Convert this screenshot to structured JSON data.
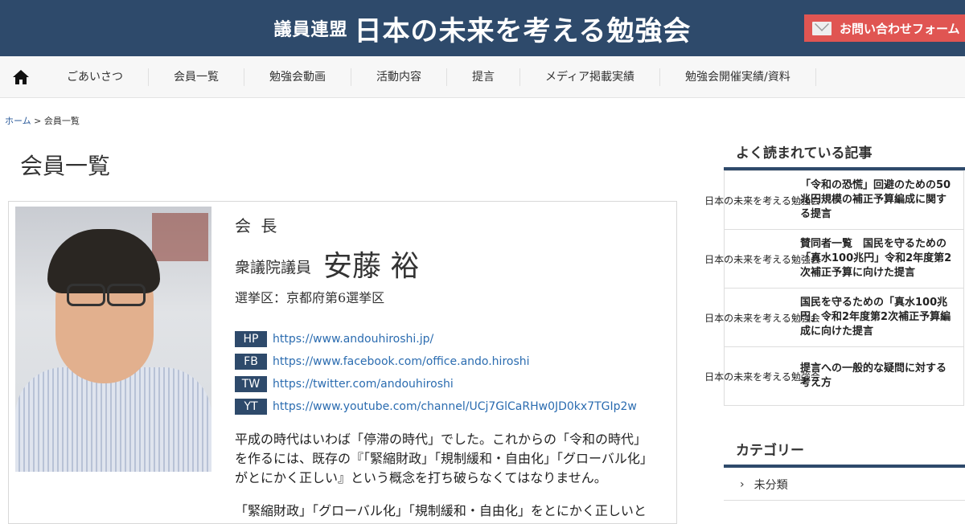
{
  "header": {
    "subtitle": "議員連盟",
    "title": "日本の未来を考える勉強会",
    "contact_label": "お問い合わせフォーム",
    "bg": "#2e4a6b",
    "contact_bg": "#e05552"
  },
  "nav": {
    "home_icon": "home-icon",
    "items": [
      "ごあいさつ",
      "会員一覧",
      "勉強会動画",
      "活動内容",
      "提言",
      "メディア掲載実績",
      "勉強会開催実績/資料"
    ]
  },
  "breadcrumb": {
    "home": "ホーム",
    "sep": ">",
    "current": "会員一覧"
  },
  "page_title": "会員一覧",
  "member": {
    "role": "会 長",
    "house": "衆議院議員",
    "name": "安藤 裕",
    "district": "選挙区：京都府第6選挙区",
    "links": [
      {
        "tag": "HP",
        "url": "https://www.andouhiroshi.jp/"
      },
      {
        "tag": "FB",
        "url": "https://www.facebook.com/office.ando.hiroshi"
      },
      {
        "tag": "TW",
        "url": "https://twitter.com/andouhiroshi"
      },
      {
        "tag": "YT",
        "url": "https://www.youtube.com/channel/UCj7GlCaRHw0JD0kx7TGIp2w"
      }
    ],
    "description": "平成の時代はいわば「停滞の時代」でした。これからの「令和の時代」を作るには、既存の『「緊縮財政」「規制緩和・自由化」「グローバル化」がとにかく正しい』という概念を打ち破らなくてはなりません。",
    "description_cut": "「緊縮財政」「グローバル化」「規制緩和・自由化」をとにかく正しいと"
  },
  "sidebar": {
    "popular_heading": "よく読まれている記事",
    "thumb_text": "日本の未来を考える勉強会",
    "popular": [
      "「令和の恐慌」回避のための50兆円規模の補正予算編成に関する提言",
      "賛同者一覧　国民を守るための「真水100兆円」令和2年度第2次補正予算に向けた提言",
      "国民を守るための「真水100兆円」令和2年度第2次補正予算編成に向けた提言",
      "提言への一般的な疑問に対する考え方"
    ],
    "category_heading": "カテゴリー",
    "categories": [
      "未分類"
    ]
  }
}
